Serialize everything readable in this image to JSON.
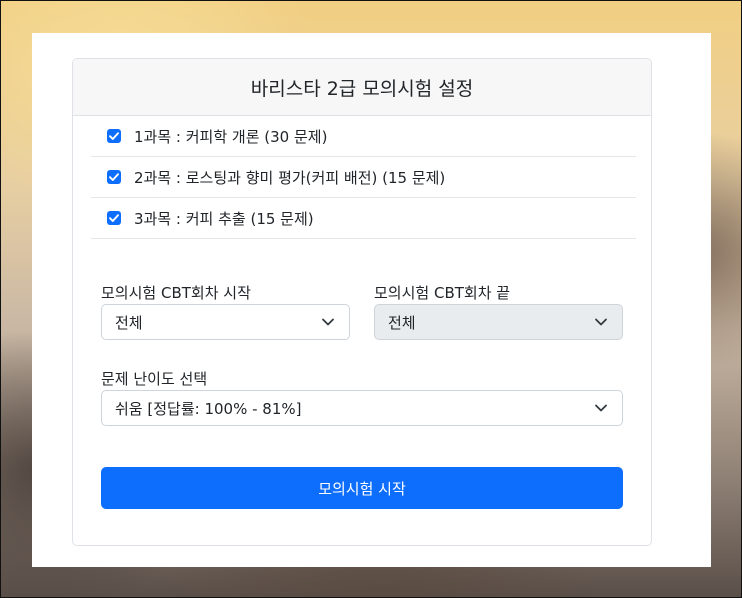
{
  "header": {
    "title": "바리스타 2급 모의시험 설정"
  },
  "subjects": [
    {
      "label": "1과목 : 커피학 개론 (30 문제)",
      "checked": true
    },
    {
      "label": "2과목 : 로스팅과 향미 평가(커피 배전) (15 문제)",
      "checked": true
    },
    {
      "label": "3과목 : 커피 추출 (15 문제)",
      "checked": true
    }
  ],
  "round_start": {
    "label": "모의시험 CBT회차 시작",
    "value": "전체"
  },
  "round_end": {
    "label": "모의시험 CBT회차 끝",
    "value": "전체",
    "disabled": true
  },
  "difficulty": {
    "label": "문제 난이도 선택",
    "value": "쉬움 [정답률: 100% - 81%]"
  },
  "start_button": {
    "label": "모의시험 시작"
  },
  "colors": {
    "primary": "#0d6efd",
    "header_bg": "#f7f7f7",
    "disabled_bg": "#e9ecef"
  },
  "icons": {
    "checkbox": "check-icon",
    "select_arrow": "chevron-down-icon"
  }
}
